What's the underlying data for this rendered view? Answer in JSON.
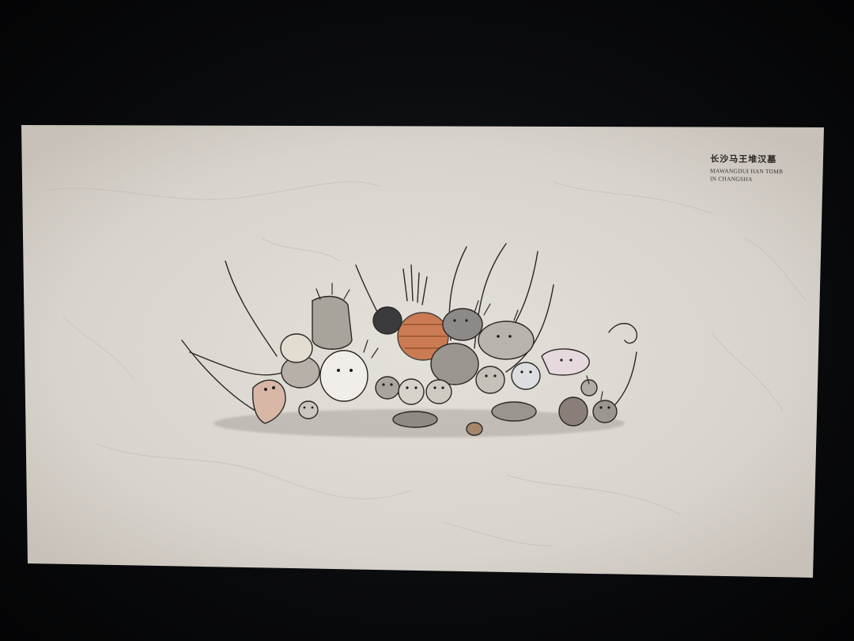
{
  "caption": {
    "title_cn": "长沙马王堆汉墓",
    "title_en_line1": "MAWANGDUI HAN TOMB",
    "title_en_line2": "IN CHANGSHA"
  },
  "colors": {
    "paper": "#d9d4cd",
    "paper_edge": "#c9c3bb",
    "ink": "#2b2724",
    "accent_orange": "#c76a3c",
    "shadow_grey": "#8c8780"
  },
  "icons": {
    "artwork": "mythical-creatures-illustration"
  }
}
